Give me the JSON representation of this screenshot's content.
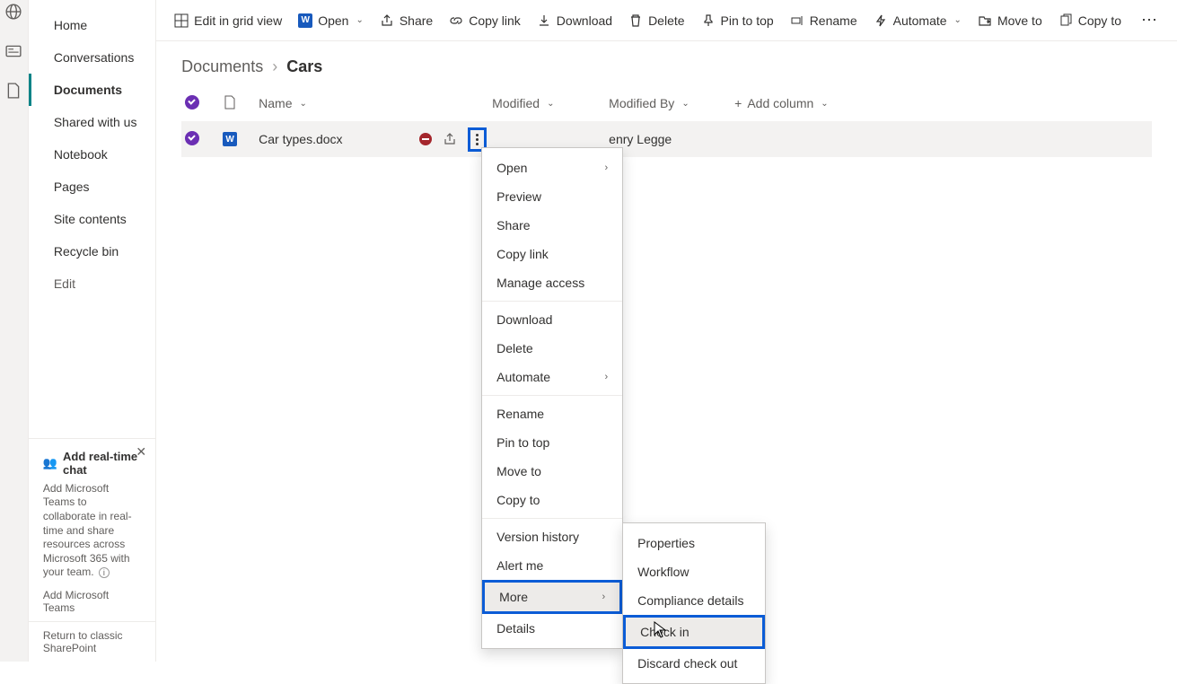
{
  "rail": {
    "icons": [
      "globe-icon",
      "news-icon",
      "file-icon"
    ]
  },
  "sidebar": {
    "items": [
      {
        "label": "Home"
      },
      {
        "label": "Conversations"
      },
      {
        "label": "Documents",
        "active": true
      },
      {
        "label": "Shared with us"
      },
      {
        "label": "Notebook"
      },
      {
        "label": "Pages"
      },
      {
        "label": "Site contents"
      },
      {
        "label": "Recycle bin"
      },
      {
        "label": "Edit",
        "sub": true
      }
    ],
    "promo": {
      "title": "Add real-time chat",
      "body": "Add Microsoft Teams to collaborate in real-time and share resources across Microsoft 365 with your team.",
      "link": "Add Microsoft Teams"
    },
    "classic": "Return to classic SharePoint"
  },
  "cmdbar": {
    "edit_grid": "Edit in grid view",
    "open": "Open",
    "share": "Share",
    "copy_link": "Copy link",
    "download": "Download",
    "delete": "Delete",
    "pin": "Pin to top",
    "rename": "Rename",
    "automate": "Automate",
    "move": "Move to",
    "copy": "Copy to"
  },
  "crumbs": {
    "parent": "Documents",
    "current": "Cars"
  },
  "columns": {
    "name": "Name",
    "modified": "Modified",
    "modified_by": "Modified By",
    "add": "Add column"
  },
  "row": {
    "filename": "Car types.docx",
    "modified_by": "enry Legge"
  },
  "context_menu": {
    "open": "Open",
    "preview": "Preview",
    "share": "Share",
    "copy_link": "Copy link",
    "manage_access": "Manage access",
    "download": "Download",
    "delete": "Delete",
    "automate": "Automate",
    "rename": "Rename",
    "pin": "Pin to top",
    "move": "Move to",
    "copy": "Copy to",
    "version": "Version history",
    "alert": "Alert me",
    "more": "More",
    "details": "Details"
  },
  "submenu": {
    "properties": "Properties",
    "workflow": "Workflow",
    "compliance": "Compliance details",
    "checkin": "Check in",
    "discard": "Discard check out"
  }
}
